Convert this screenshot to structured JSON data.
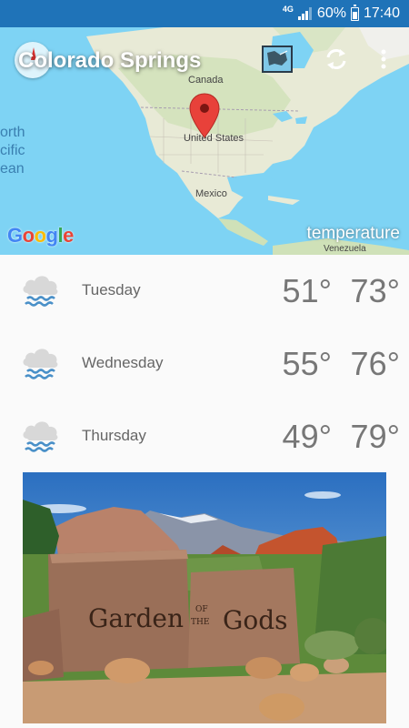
{
  "status_bar": {
    "network": "4G",
    "battery": "60%",
    "time": "17:40"
  },
  "header": {
    "city": "Colorado Springs"
  },
  "map": {
    "labels": {
      "canada": "Canada",
      "united_states": "United States",
      "mexico": "Mexico",
      "venezuela": "Venezuela",
      "ocean_line1": "orth",
      "ocean_line2": "cific",
      "ocean_line3": "ean"
    },
    "provider": "Google",
    "layer_label": "temperature"
  },
  "forecast": [
    {
      "day": "Tuesday",
      "low": "51°",
      "high": "73°",
      "icon": "rain-cloud-icon"
    },
    {
      "day": "Wednesday",
      "low": "55°",
      "high": "76°",
      "icon": "rain-cloud-icon"
    },
    {
      "day": "Thursday",
      "low": "49°",
      "high": "79°",
      "icon": "rain-cloud-icon"
    }
  ],
  "photo": {
    "sign_word1": "Garden",
    "sign_word2": "OF",
    "sign_word3": "THE",
    "sign_word4": "Gods"
  },
  "colors": {
    "status_bar": "#1f73b8",
    "map_water": "#7ed3f4",
    "pin": "#e8413a",
    "cloud": "#d8d8d8",
    "rain": "#4a90c8"
  }
}
